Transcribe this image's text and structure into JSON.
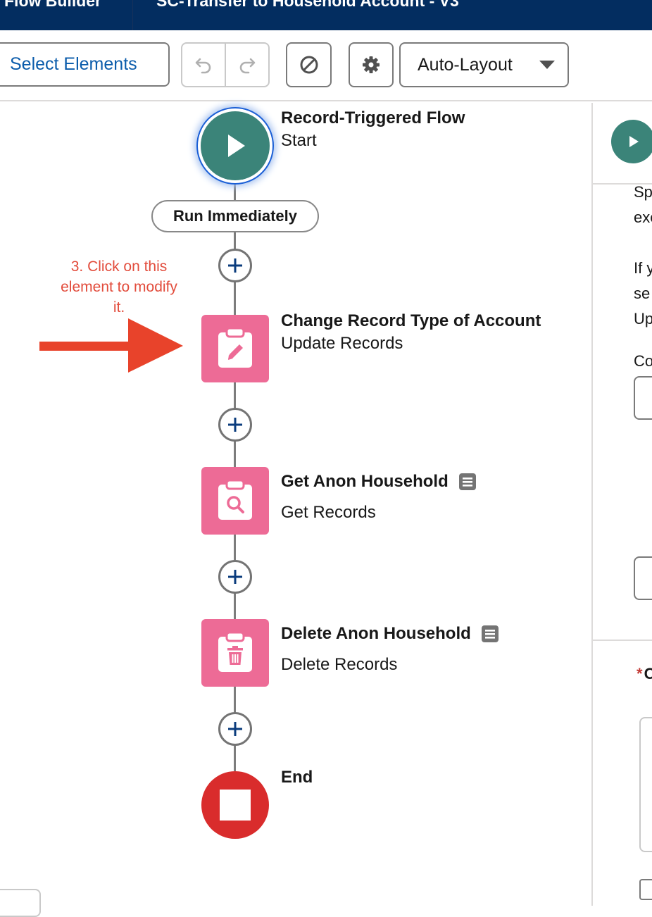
{
  "header": {
    "app_title": "Flow Builder",
    "flow_title": "SC-Transfer to Household Account - V3"
  },
  "toolbar": {
    "select_elements_label": "Select Elements",
    "undo_icon": "undo-icon",
    "redo_icon": "redo-icon",
    "debug_icon": "cancel-circle-icon",
    "settings_icon": "gear-icon",
    "layout_selected": "Auto-Layout"
  },
  "flow": {
    "start": {
      "title": "Record-Triggered Flow",
      "subtitle": "Start"
    },
    "path_label": "Run Immediately",
    "elements": [
      {
        "title": "Change Record Type of Account",
        "subtitle": "Update Records",
        "icon": "edit-icon"
      },
      {
        "title": "Get Anon Household",
        "subtitle": "Get Records",
        "icon": "search-icon"
      },
      {
        "title": "Delete Anon Household",
        "subtitle": "Delete Records",
        "icon": "trash-icon"
      }
    ],
    "end": {
      "title": "End"
    }
  },
  "annotation": {
    "lines": [
      "3. Click on this",
      "element to modify",
      "it."
    ]
  },
  "panel": {
    "lines": [
      "Sp",
      "exe",
      "If y",
      "se",
      "Up",
      "Co"
    ],
    "required_label": "C"
  },
  "colors": {
    "header_bg": "#032d60",
    "start_green": "#3b8479",
    "element_pink": "#ed6b96",
    "end_red": "#d92c2c",
    "annotation_red": "#e24c3c",
    "link_blue": "#0b5cab"
  }
}
